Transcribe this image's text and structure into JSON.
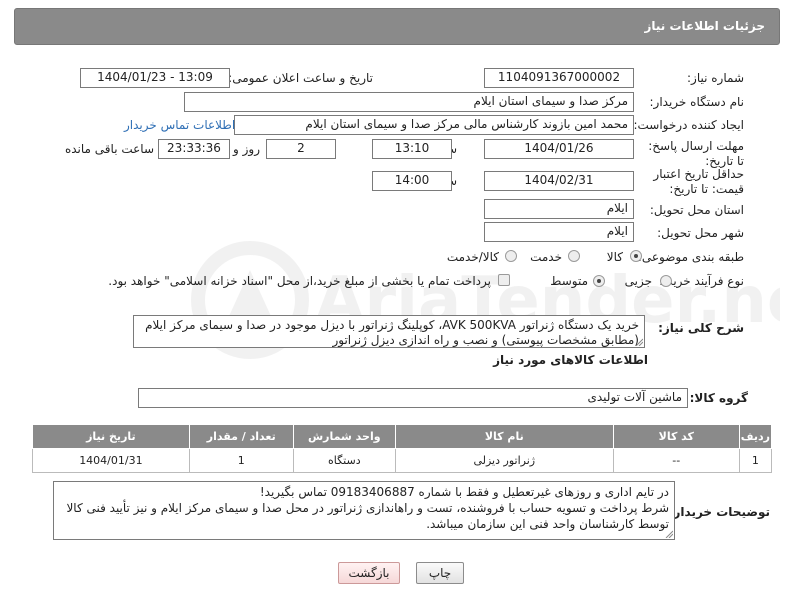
{
  "header": {
    "title": "جزئیات اطلاعات نیاز"
  },
  "form": {
    "need_number_label": "شماره نیاز:",
    "need_number": "1104091367000002",
    "announce_label": "تاریخ و ساعت اعلان عمومی:",
    "announce_value": "1404/01/23 - 13:09",
    "buyer_org_label": "نام دستگاه خریدار:",
    "buyer_org": "مرکز صدا و سیمای استان ایلام",
    "requester_label": "ایجاد کننده درخواست:",
    "requester": "محمد امین بازوند کارشناس مالی مرکز صدا و سیمای استان ایلام",
    "contact_link": "اطلاعات تماس خریدار",
    "reply_deadline_label": "مهلت ارسال پاسخ: تا تاریخ:",
    "reply_date": "1404/01/26",
    "time_label": "ساعت",
    "reply_time": "13:10",
    "days_value": "2",
    "days_label": "روز و",
    "remaining_value": "23:33:36",
    "remaining_label": "ساعت باقی مانده",
    "price_validity_label": "حداقل تاریخ اعتبار قیمت: تا تاریخ:",
    "price_date": "1404/02/31",
    "price_time": "14:00",
    "province_label": "استان محل تحویل:",
    "province": "ایلام",
    "city_label": "شهر محل تحویل:",
    "city": "ایلام",
    "category_label": "طبقه بندی موضوعی:",
    "category_options": [
      "کالا",
      "خدمت",
      "کالا/خدمت"
    ],
    "process_label": "نوع فرآیند خرید :",
    "process_options": [
      "جزیی",
      "متوسط"
    ],
    "payment_note": "پرداخت تمام یا بخشی از مبلغ خرید،از محل \"اسناد خزانه اسلامی\" خواهد بود.",
    "description_label": "شرح کلی نیاز:",
    "description": "خرید یک دستگاه ژنراتور AVK 500KVA، کوپلینگ ژنراتور با دیزل موجود در صدا و سیمای مرکز ایلام (مطابق مشخصات پیوستی) و نصب و راه اندازی دیزل ژنراتور"
  },
  "goods": {
    "section_title": "اطلاعات کالاهای مورد نیاز",
    "group_label": "گروه کالا:",
    "group_value": "ماشین آلات تولیدی",
    "columns": [
      "ردیف",
      "کد کالا",
      "نام کالا",
      "واحد شمارش",
      "تعداد / مقدار",
      "تاریخ نیاز"
    ],
    "rows": [
      [
        "1",
        "--",
        "ژنراتور دیزلی",
        "دستگاه",
        "1",
        "1404/01/31"
      ]
    ]
  },
  "buyer_notes": {
    "label": "توضیحات خریدار:",
    "line1": "در تایم اداری و روزهای غیرتعطیل و فقط با شماره 09183406887 تماس بگیرید!",
    "line2": "شرط پرداخت و تسویه حساب با فروشنده، تست و راهاندازی ژنراتور در محل صدا و سیمای مرکز ایلام و نیز تأیید فنی کالا",
    "line3": "توسط کارشناسان واحد فنی این سازمان میباشد."
  },
  "buttons": {
    "print": "چاپ",
    "back": "بازگشت"
  },
  "watermark": "AriaTender.neT"
}
